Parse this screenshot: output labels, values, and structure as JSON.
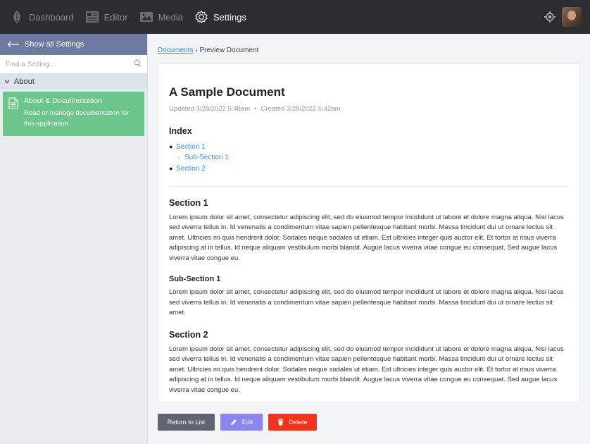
{
  "topnav": {
    "items": [
      {
        "label": "Dashboard",
        "icon": "leaf-icon"
      },
      {
        "label": "Editor",
        "icon": "newspaper-icon"
      },
      {
        "label": "Media",
        "icon": "image-icon"
      },
      {
        "label": "Settings",
        "icon": "gear-icon",
        "active": true
      }
    ]
  },
  "sidebar": {
    "show_all": "Show all Settings",
    "search_placeholder": "Find a Setting...",
    "group": "About",
    "card": {
      "title": "About & Documentation",
      "description": "Read or manage documentation for this application."
    }
  },
  "breadcrumb": {
    "link": "Documents",
    "separator": "›",
    "current": "Preview Document"
  },
  "document": {
    "title": "A Sample Document",
    "updated": "Updated 3/28/2022 5:48am",
    "created": "Created 3/28/2022 5:42am",
    "meta_separator": "•",
    "index_title": "Index",
    "index": {
      "section1": "Section 1",
      "subsection1": "Sub-Section 1",
      "section2": "Section 2"
    },
    "sections": [
      {
        "heading": "Section 1",
        "body": "Lorem ipsum dolor sit amet, consectetur adipiscing elit, sed do eiusmod tempor incididunt ut labore et dolore magna aliqua. Nisi lacus sed viverra tellus in. Id venenatis a condimentum vitae sapien pellentesque habitant morbi. Massa tincidunt dui ut ornare lectus sit amet. Ultricies mi quis hendrerit dolor. Sodales neque sodales ut etiam. Est ultricies integer quis auctor elit. Et tortor at risus viverra adipiscing at in tellus. Id neque aliquam vestibulum morbi blandit. Augue lacus viverra vitae congue eu consequat. Sed augue lacus viverra vitae congue eu."
      },
      {
        "heading": "Sub-Section 1",
        "body": "Lorem ipsum dolor sit amet, consectetur adipiscing elit, sed do eiusmod tempor incididunt ut labore et dolore magna aliqua. Nisi lacus sed viverra tellus in. Id venenatis a condimentum vitae sapien pellentesque habitant morbi. Massa tincidunt dui ut ornare lectus sit amet."
      },
      {
        "heading": "Section 2",
        "body": "Lorem ipsum dolor sit amet, consectetur adipiscing elit, sed do eiusmod tempor incididunt ut labore et dolore magna aliqua. Nisi lacus sed viverra tellus in. Id venenatis a condimentum vitae sapien pellentesque habitant morbi. Massa tincidunt dui ut ornare lectus sit amet. Ultricies mi quis hendrerit dolor. Sodales neque sodales ut etiam. Est ultricies integer quis auctor elit. Et tortor at risus viverra adipiscing at in tellus. Id neque aliquam vestibulum morbi blandit. Augue lacus viverra vitae congue eu consequat. Sed augue lacus viverra vitae congue eu."
      }
    ]
  },
  "buttons": {
    "return": "Return to List",
    "edit": "Edit",
    "delete": "Delete"
  },
  "colors": {
    "topbar": "#2b2d30",
    "show_all_bg": "#6f7aa3",
    "card_green": "#6cc58a",
    "link": "#3a8fd6",
    "btn_return": "#5f6570",
    "btn_edit": "#8c85f1",
    "btn_delete": "#f5321e"
  }
}
